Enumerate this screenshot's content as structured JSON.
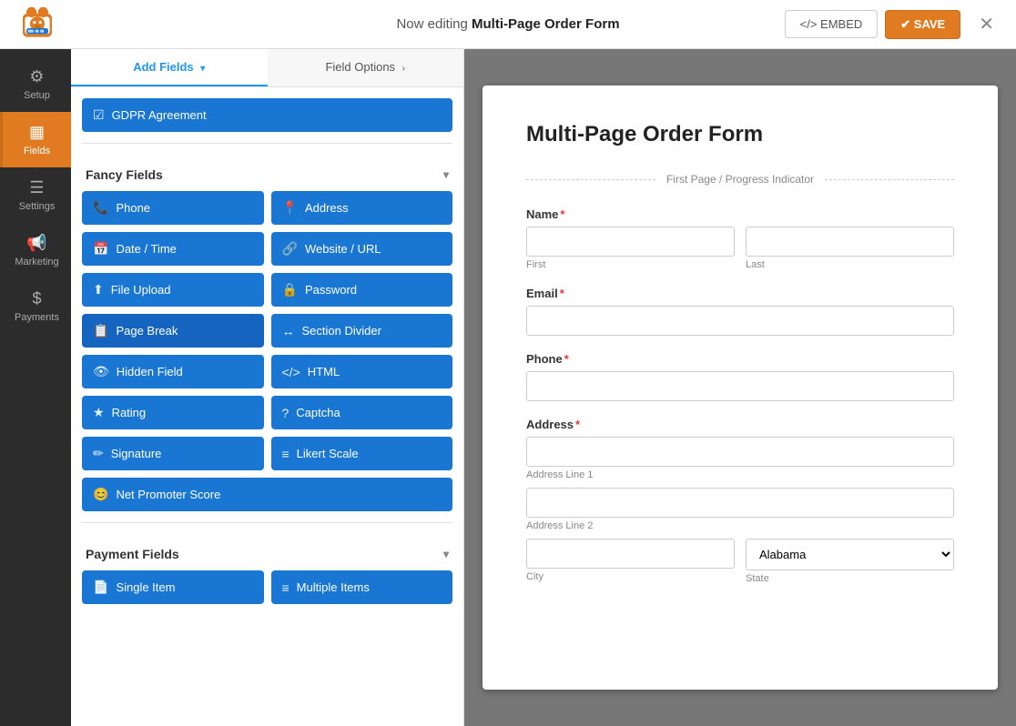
{
  "app": {
    "logo_alt": "WPForms Bear Logo"
  },
  "topbar": {
    "editing_prefix": "Now editing ",
    "form_name": "Multi-Page Order Form",
    "embed_label": "</>  EMBED",
    "save_label": "✔ SAVE",
    "close_label": "✕"
  },
  "tabs_bar": {
    "tabs": [
      {
        "label": "Fields",
        "active": true
      }
    ]
  },
  "sidebar": {
    "items": [
      {
        "id": "setup",
        "label": "Setup",
        "icon": "⚙"
      },
      {
        "id": "fields",
        "label": "Fields",
        "icon": "▦",
        "active": true
      },
      {
        "id": "settings",
        "label": "Settings",
        "icon": "☰"
      },
      {
        "id": "marketing",
        "label": "Marketing",
        "icon": "📢"
      },
      {
        "id": "payments",
        "label": "Payments",
        "icon": "$"
      }
    ]
  },
  "fields_panel": {
    "tab_add": "Add Fields",
    "tab_add_arrow": "▾",
    "tab_options": "Field Options",
    "tab_options_arrow": "›",
    "sections": [
      {
        "id": "gdpr",
        "buttons": [
          {
            "id": "gdpr-agreement",
            "icon": "☑",
            "label": "GDPR Agreement",
            "full_width": false
          }
        ]
      },
      {
        "id": "fancy-fields",
        "label": "Fancy Fields",
        "collapsed": false,
        "buttons": [
          {
            "id": "phone",
            "icon": "📞",
            "label": "Phone"
          },
          {
            "id": "address",
            "icon": "📍",
            "label": "Address"
          },
          {
            "id": "date-time",
            "icon": "📅",
            "label": "Date / Time"
          },
          {
            "id": "website-url",
            "icon": "🔗",
            "label": "Website / URL"
          },
          {
            "id": "file-upload",
            "icon": "⬆",
            "label": "File Upload"
          },
          {
            "id": "password",
            "icon": "🔒",
            "label": "Password"
          },
          {
            "id": "page-break",
            "icon": "📋",
            "label": "Page Break",
            "active_hover": true
          },
          {
            "id": "section-divider",
            "icon": "↔",
            "label": "Section Divider"
          },
          {
            "id": "hidden-field",
            "icon": "👁",
            "label": "Hidden Field"
          },
          {
            "id": "html",
            "icon": "</>",
            "label": "HTML"
          },
          {
            "id": "rating",
            "icon": "★",
            "label": "Rating"
          },
          {
            "id": "captcha",
            "icon": "?",
            "label": "Captcha"
          },
          {
            "id": "signature",
            "icon": "✏",
            "label": "Signature"
          },
          {
            "id": "likert-scale",
            "icon": "≡",
            "label": "Likert Scale"
          },
          {
            "id": "net-promoter-score",
            "icon": "😊",
            "label": "Net Promoter Score",
            "full_width": true
          }
        ]
      },
      {
        "id": "payment-fields",
        "label": "Payment Fields",
        "collapsed": false,
        "buttons": [
          {
            "id": "single-item",
            "icon": "📄",
            "label": "Single Item"
          },
          {
            "id": "multiple-items",
            "icon": "≡",
            "label": "Multiple Items"
          }
        ]
      }
    ]
  },
  "form_preview": {
    "title": "Multi-Page Order Form",
    "page_indicator": "First Page / Progress Indicator",
    "fields": [
      {
        "id": "name",
        "label": "Name",
        "required": true,
        "type": "name",
        "sub_fields": [
          {
            "placeholder": "",
            "sub_label": "First"
          },
          {
            "placeholder": "",
            "sub_label": "Last"
          }
        ]
      },
      {
        "id": "email",
        "label": "Email",
        "required": true,
        "type": "text"
      },
      {
        "id": "phone",
        "label": "Phone",
        "required": true,
        "type": "text"
      },
      {
        "id": "address",
        "label": "Address",
        "required": true,
        "type": "address",
        "sub_labels": [
          "Address Line 1",
          "Address Line 2",
          "City",
          "State"
        ],
        "state_default": "Alabama"
      }
    ]
  }
}
